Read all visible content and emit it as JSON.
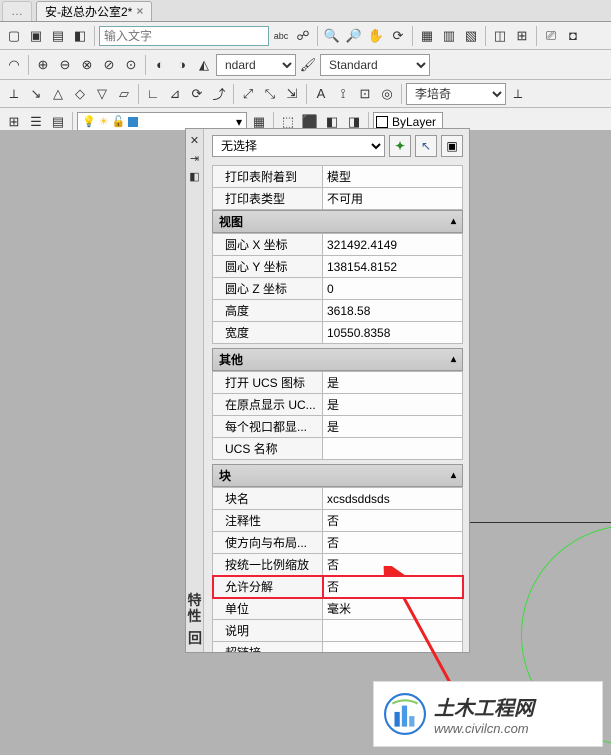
{
  "tab": {
    "label": "安-赵总办公室2*"
  },
  "toolbar1": {
    "inputPlaceholder": "输入文字"
  },
  "toolbar2": {
    "ndard": "ndard",
    "standard": "Standard"
  },
  "toolbar3": {
    "lipeiqi": "李培奇"
  },
  "toolbar4": {
    "bylayer": "ByLayer"
  },
  "palette": {
    "noSelect": "无选择",
    "sidebarLabel1": "特",
    "sidebarLabel2": "性",
    "sidebarBottom": "回",
    "plot": {
      "attachedTo_l": "打印表附着到",
      "attachedTo_v": "模型",
      "tableType_l": "打印表类型",
      "tableType_v": "不可用"
    },
    "view": {
      "header": "视图",
      "cx_l": "圆心 X 坐标",
      "cx_v": "321492.4149",
      "cy_l": "圆心 Y 坐标",
      "cy_v": "138154.8152",
      "cz_l": "圆心 Z 坐标",
      "cz_v": "0",
      "h_l": "高度",
      "h_v": "3618.58",
      "w_l": "宽度",
      "w_v": "10550.8358"
    },
    "other": {
      "header": "其他",
      "ucsIcon_l": "打开 UCS 图标",
      "ucsIcon_v": "是",
      "ucsOrigin_l": "在原点显示 UC...",
      "ucsOrigin_v": "是",
      "ucsPerVp_l": "每个视口都显...",
      "ucsPerVp_v": "是",
      "ucsName_l": "UCS 名称",
      "ucsName_v": ""
    },
    "block": {
      "header": "块",
      "name_l": "块名",
      "name_v": "xcsdsddsds",
      "anno_l": "注释性",
      "anno_v": "否",
      "orient_l": "使方向与布局...",
      "orient_v": "否",
      "scale_l": "按统一比例缩放",
      "scale_v": "否",
      "explode_l": "允许分解",
      "explode_v": "否",
      "unit_l": "单位",
      "unit_v": "毫米",
      "desc_l": "说明",
      "desc_v": "",
      "hyper_l": "超链接",
      "hyper_v": ""
    }
  },
  "watermark": {
    "name": "土木工程网",
    "url": "www.civilcn.com"
  }
}
